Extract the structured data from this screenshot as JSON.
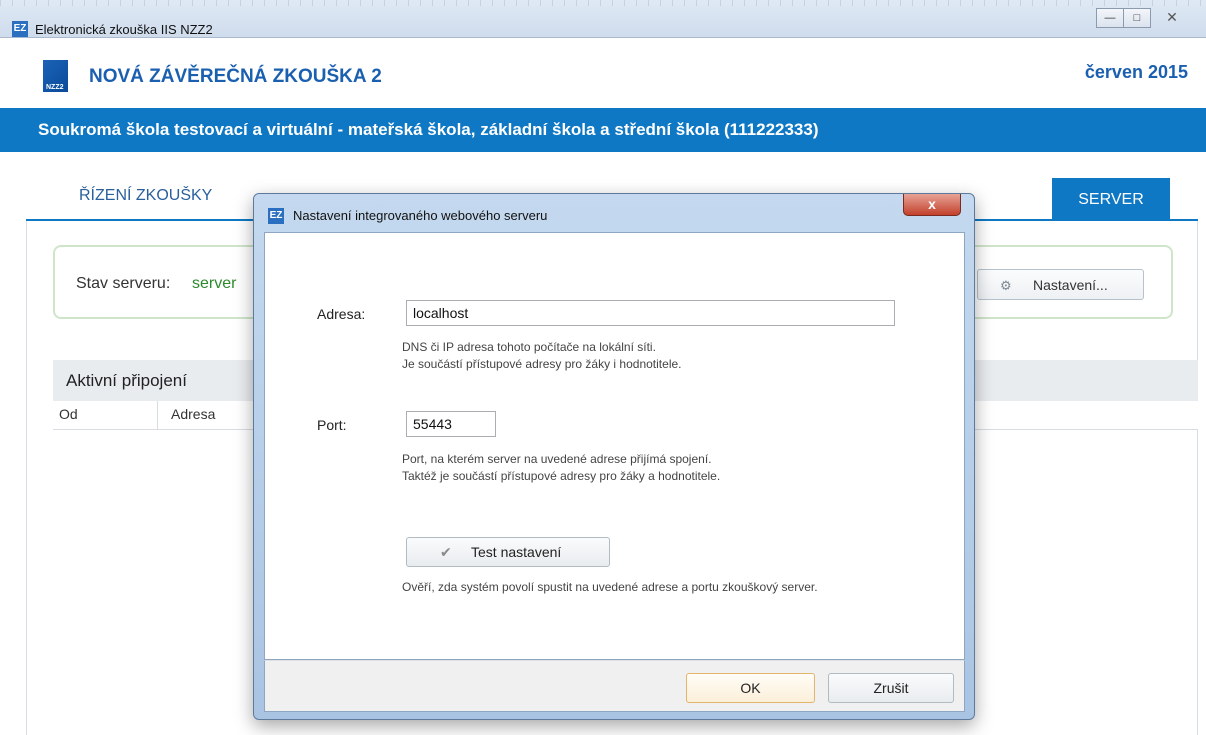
{
  "window": {
    "title": "Elektronická zkouška IIS NZZ2",
    "icon": "EZ",
    "controls": {
      "minimize": "—",
      "maximize": "□",
      "close": "✕"
    }
  },
  "header": {
    "logo_sub": "NZZ2",
    "app_name": "NOVÁ ZÁVĚREČNÁ ZKOUŠKA 2",
    "date": "červen 2015",
    "school": "Soukromá škola testovací a virtuální - mateřská škola, základní škola a střední škola (111222333)"
  },
  "tabs": [
    {
      "label": "ŘÍZENÍ ZKOUŠKY",
      "active": false
    },
    {
      "label": "SERVER",
      "active": true
    }
  ],
  "status": {
    "label": "Stav serveru:",
    "value": "server",
    "settings_button": "Nastavení..."
  },
  "connections": {
    "title": "Aktivní připojení",
    "columns": [
      "Od",
      "Adresa"
    ]
  },
  "dialog": {
    "icon": "EZ",
    "title": "Nastavení integrovaného webového serveru",
    "close": "x",
    "address": {
      "label": "Adresa:",
      "value": "localhost",
      "hint_1": "DNS či IP adresa tohoto počítače na lokální síti.",
      "hint_2": "Je součástí přístupové adresy pro žáky i hodnotitele."
    },
    "port": {
      "label": "Port:",
      "value": "55443",
      "hint_1": "Port, na kterém server na uvedené adrese přijímá spojení.",
      "hint_2": "Taktéž je součástí přístupové adresy pro žáky a hodnotitele."
    },
    "test_button": "Test nastavení",
    "test_hint": "Ověří, zda systém povolí spustit na uvedené adrese a portu zkouškový server.",
    "ok": "OK",
    "cancel": "Zrušit"
  }
}
